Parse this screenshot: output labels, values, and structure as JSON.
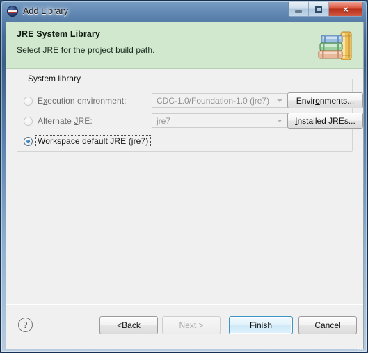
{
  "window": {
    "title": "Add Library",
    "icon": "eclipse-globe-icon",
    "caption": {
      "minimize_label": "",
      "maximize_label": "",
      "close_label": "×"
    }
  },
  "banner": {
    "title": "JRE System Library",
    "subtitle": "Select JRE for the project build path.",
    "icon": "books-stack-icon",
    "background_color": "#d1e8cf"
  },
  "group": {
    "label": "System library",
    "options": [
      {
        "id": "execution-environment",
        "label_pre": "E",
        "label_mnemonic": "x",
        "label_post": "ecution environment:",
        "label_full": "Execution environment:",
        "selected": false,
        "enabled": false,
        "combo_value": "CDC-1.0/Foundation-1.0 (jre7)",
        "button_pre": "Envir",
        "button_mnemonic": "o",
        "button_post": "nments...",
        "button_full": "Environments..."
      },
      {
        "id": "alternate-jre",
        "label_pre": "Alternate ",
        "label_mnemonic": "J",
        "label_post": "RE:",
        "label_full": "Alternate JRE:",
        "selected": false,
        "enabled": false,
        "combo_value": "jre7",
        "button_pre": "",
        "button_mnemonic": "I",
        "button_post": "nstalled JREs...",
        "button_full": "Installed JREs..."
      },
      {
        "id": "workspace-default-jre",
        "label_pre": "Workspace ",
        "label_mnemonic": "d",
        "label_post": "efault JRE (jre7)",
        "label_full": "Workspace default JRE (jre7)",
        "selected": true,
        "enabled": true,
        "focused": true
      }
    ]
  },
  "footer": {
    "help_label": "?",
    "buttons": [
      {
        "id": "back",
        "pre": "< ",
        "mnemonic": "B",
        "post": "ack",
        "full": "< Back",
        "enabled": true,
        "default": false
      },
      {
        "id": "next",
        "pre": "",
        "mnemonic": "N",
        "post": "ext >",
        "full": "Next >",
        "enabled": false,
        "default": false
      },
      {
        "id": "finish",
        "pre": "Finish",
        "mnemonic": "",
        "post": "",
        "full": "Finish",
        "enabled": true,
        "default": true
      },
      {
        "id": "cancel",
        "pre": "Cancel",
        "mnemonic": "",
        "post": "",
        "full": "Cancel",
        "enabled": true,
        "default": false
      }
    ]
  },
  "colors": {
    "accent": "#3d94c6",
    "banner": "#d1e8cf",
    "client_background": "#f0f0f0"
  }
}
